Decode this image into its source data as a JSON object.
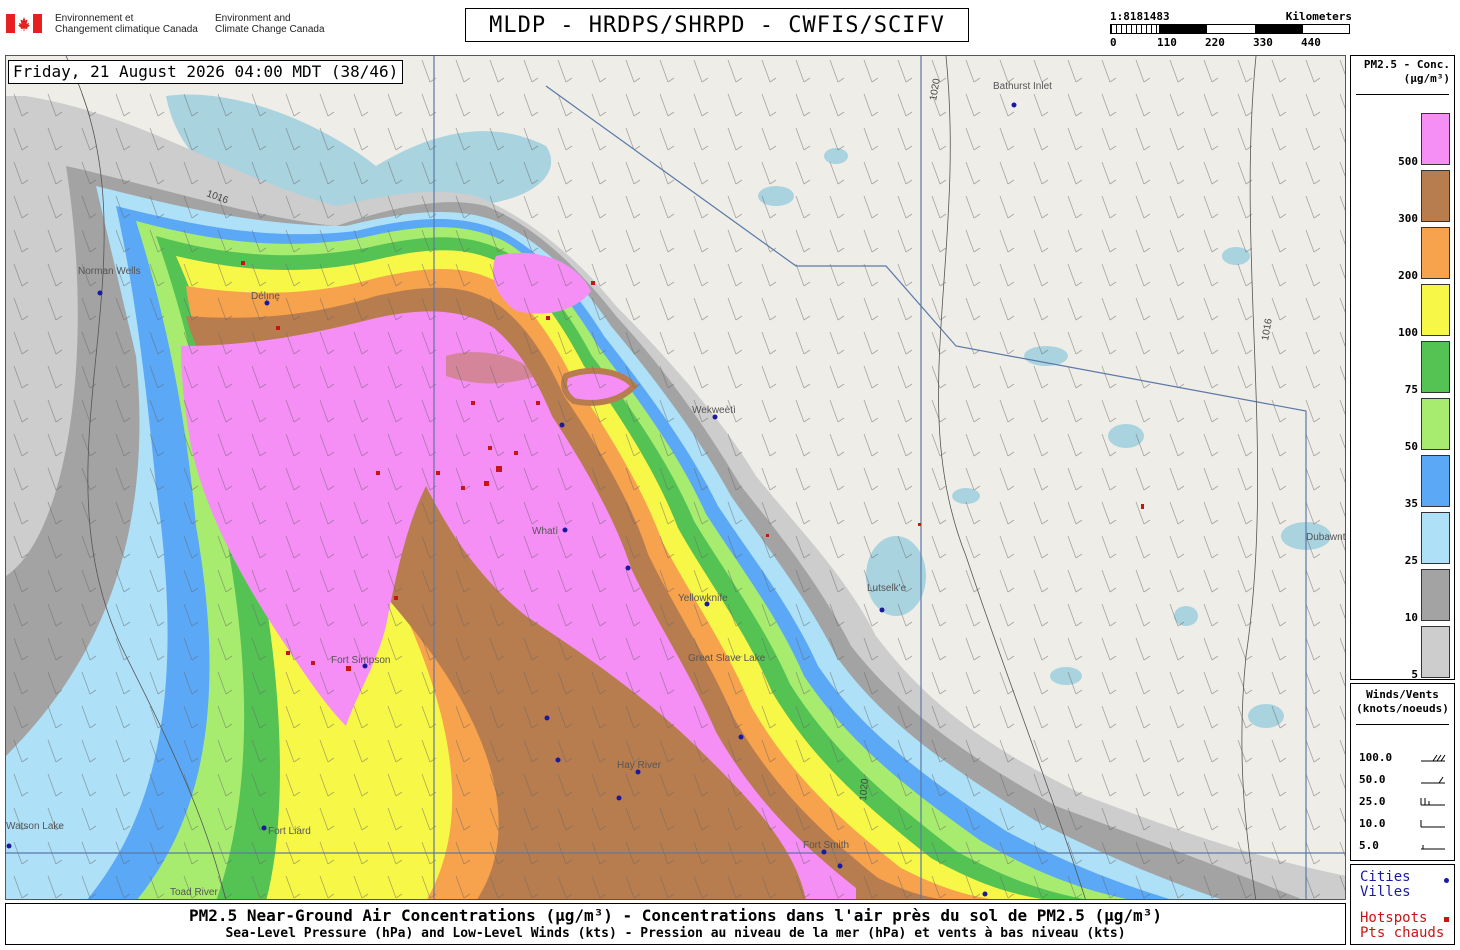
{
  "header": {
    "gov_fr": [
      "Environnement et",
      "Changement climatique Canada"
    ],
    "gov_en": [
      "Environment and",
      "Climate Change Canada"
    ],
    "title": "MLDP - HRDPS/SHRPD - CWFIS/SCIFV"
  },
  "scale": {
    "ratio": "1:8181483",
    "unit": "Kilometers",
    "ticks": [
      "0",
      "110",
      "220",
      "330",
      "440"
    ]
  },
  "time": "Friday, 21 August 2026 04:00 MDT (38/46)",
  "legend": {
    "title": [
      "PM2.5 - Conc.",
      "(μg/m³)"
    ],
    "entries": [
      {
        "label": "500",
        "color": "#f58ef5"
      },
      {
        "label": "300",
        "color": "#b87d4f"
      },
      {
        "label": "200",
        "color": "#f7a24d"
      },
      {
        "label": "100",
        "color": "#f7f748"
      },
      {
        "label": "75",
        "color": "#55c354"
      },
      {
        "label": "50",
        "color": "#a8ec6f"
      },
      {
        "label": "35",
        "color": "#5aa8f6"
      },
      {
        "label": "25",
        "color": "#aee0f7"
      },
      {
        "label": "10",
        "color": "#a3a3a3"
      },
      {
        "label": "5",
        "color": "#cdcdcd"
      }
    ]
  },
  "winds": {
    "title": [
      "Winds/Vents",
      "(knots/noeuds)"
    ],
    "rows": [
      "100.0",
      "50.0",
      "25.0",
      "10.0",
      "5.0"
    ]
  },
  "keys": {
    "cities": [
      "Cities",
      "Villes"
    ],
    "hotspots": [
      "Hotspots",
      "Pts chauds"
    ]
  },
  "footer": {
    "line1": "PM2.5 Near-Ground Air Concentrations (μg/m³) - Concentrations dans l'air près du sol de PM2.5 (μg/m³)",
    "line2": "Sea-Level Pressure (hPa) and Low-Level Winds (kts) - Pression au niveau de la mer (hPa) et vents à bas niveau (kts)"
  },
  "map": {
    "place_labels": [
      "Bathurst Inlet",
      "Norman Wells",
      "Délı̨nę",
      "Wekweètì",
      "Whatì",
      "Yellowknife",
      "Great Slave Lake",
      "Lutselk'e",
      "Hay River",
      "Fort Liard",
      "Fort Smith",
      "Fort Simpson",
      "Watson Lake",
      "Toad River",
      "Dubawnt Lake"
    ],
    "isobars": [
      "1016",
      "1020"
    ],
    "colors": {
      "land": "#efede8",
      "water": "#a9d3df",
      "border": "#5b78a8"
    }
  }
}
